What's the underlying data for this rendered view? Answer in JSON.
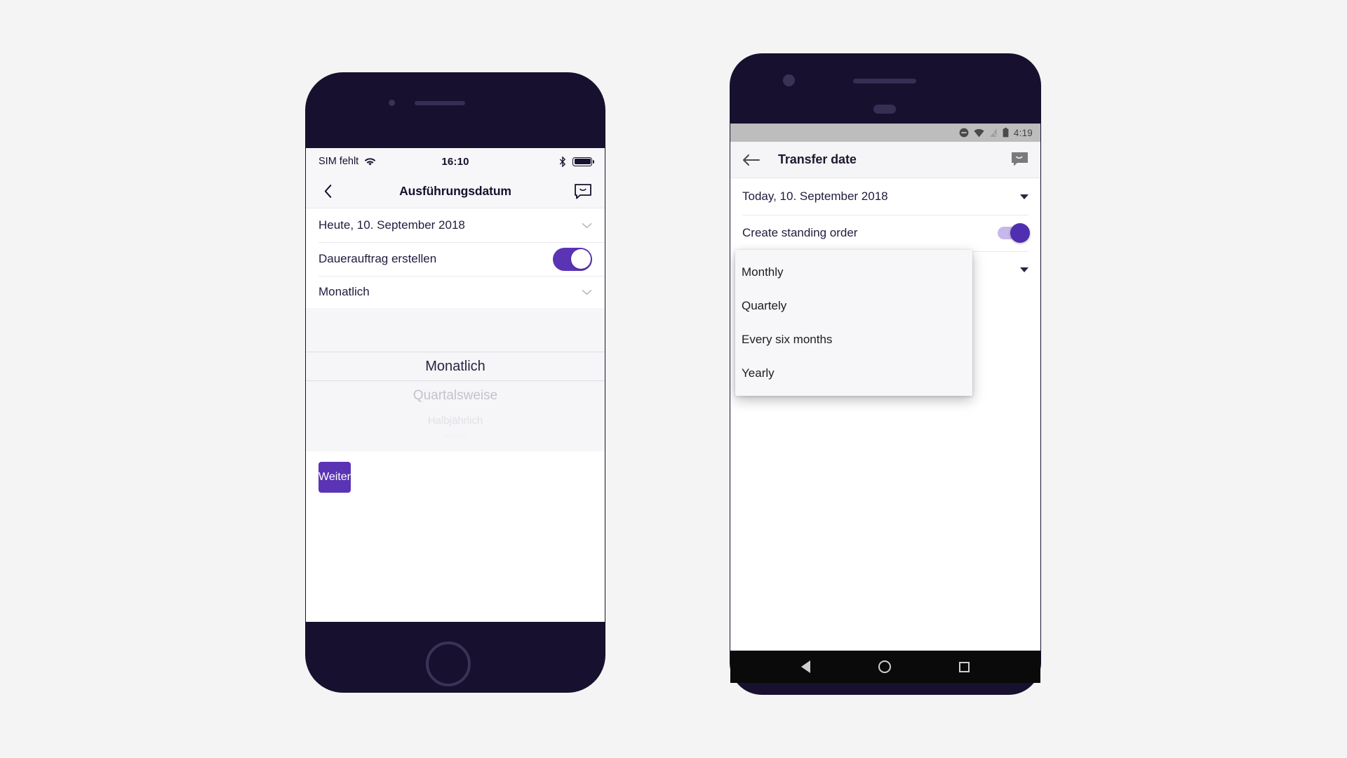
{
  "background_color": "#f4f4f4",
  "accent_color": "#5b34b5",
  "device_body_color": "#17102e",
  "ios_phone": {
    "device_name": "iphone-device",
    "status_bar": {
      "carrier": "SIM fehlt",
      "wifi_icon": "wifi-icon",
      "time": "16:10",
      "bluetooth_icon": "bluetooth-icon",
      "battery_icon": "battery-icon"
    },
    "nav_bar": {
      "back_icon": "chevron-left-icon",
      "title": "Ausführungsdatum",
      "chat_icon": "chat-bubble-icon"
    },
    "rows": {
      "date_value": "Heute, 10. September 2018",
      "date_chevron_icon": "chevron-down-icon",
      "standing_order_label": "Dauerauftrag erstellen",
      "standing_order_toggle_state": "on",
      "frequency_value": "Monatlich",
      "frequency_chevron_icon": "chevron-down-icon"
    },
    "picker": {
      "selected": "Monatlich",
      "option_2": "Quartalsweise",
      "option_3": "Halbjährlich",
      "option_4": "Jährlich"
    },
    "primary_button_label": "Weiter",
    "home_button_icon": "home-button-icon"
  },
  "android_phone": {
    "device_name": "android-device",
    "status_bar": {
      "dnd_icon": "do-not-disturb-icon",
      "wifi_icon": "wifi-icon",
      "signal_off_icon": "signal-off-icon",
      "battery_icon": "battery-icon",
      "time": "4:19"
    },
    "app_bar": {
      "back_icon": "arrow-left-icon",
      "title": "Transfer date",
      "chat_icon": "chat-bubble-icon"
    },
    "rows": {
      "date_value": "Today, 10. September 2018",
      "date_caret_icon": "caret-down-icon",
      "standing_order_label": "Create standing order",
      "standing_order_toggle_state": "on",
      "frequency_caret_icon": "caret-down-icon"
    },
    "dropdown": {
      "items": [
        {
          "label": "Monthly"
        },
        {
          "label": "Quartely"
        },
        {
          "label": "Every six months"
        },
        {
          "label": "Yearly"
        }
      ]
    },
    "nav_bar": {
      "back_icon": "nav-back-triangle-icon",
      "home_icon": "nav-home-circle-icon",
      "recents_icon": "nav-recents-square-icon"
    }
  }
}
